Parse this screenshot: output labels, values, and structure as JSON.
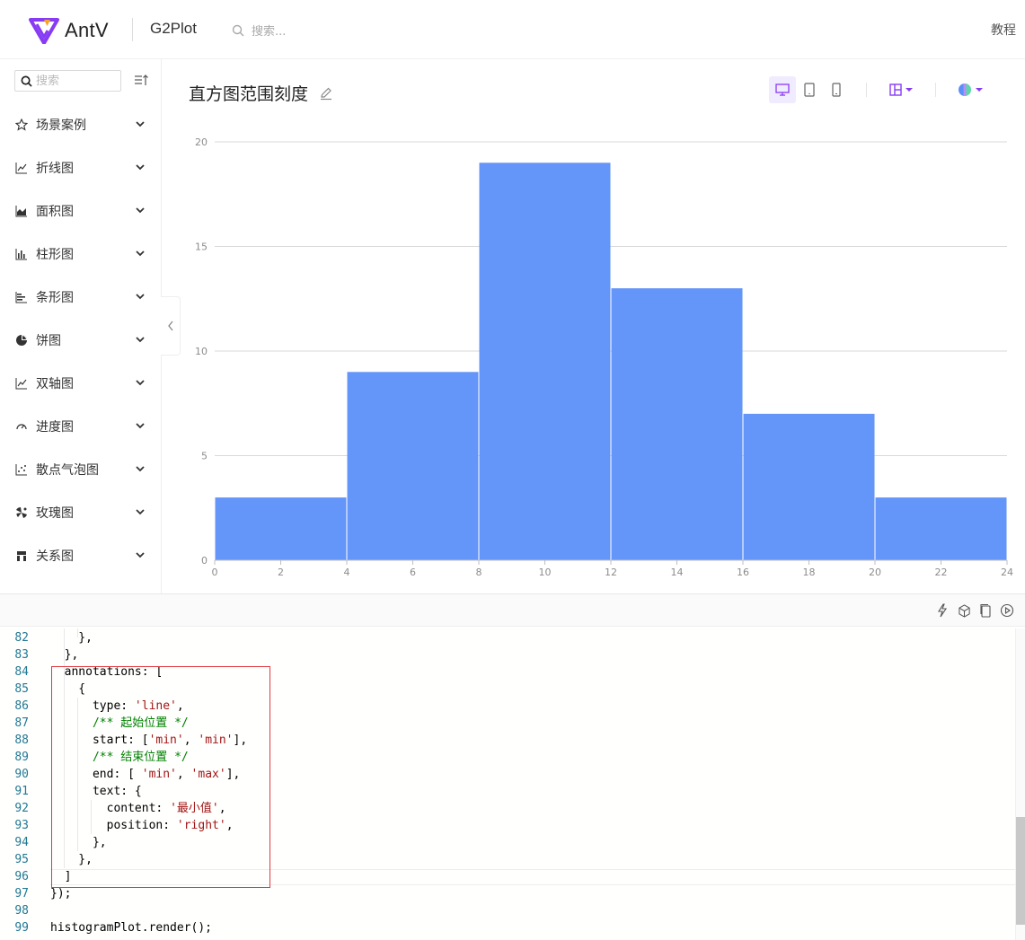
{
  "header": {
    "brand": "AntV",
    "product": "G2Plot",
    "search_placeholder": "搜索...",
    "tutorial": "教程"
  },
  "sidebar": {
    "search_placeholder": "搜索",
    "items": [
      {
        "label": "场景案例",
        "icon": "star-icon"
      },
      {
        "label": "折线图",
        "icon": "line-chart-icon"
      },
      {
        "label": "面积图",
        "icon": "area-chart-icon"
      },
      {
        "label": "柱形图",
        "icon": "column-chart-icon"
      },
      {
        "label": "条形图",
        "icon": "bar-chart-icon"
      },
      {
        "label": "饼图",
        "icon": "pie-chart-icon"
      },
      {
        "label": "双轴图",
        "icon": "dual-axes-icon"
      },
      {
        "label": "进度图",
        "icon": "gauge-icon"
      },
      {
        "label": "散点气泡图",
        "icon": "scatter-icon"
      },
      {
        "label": "玫瑰图",
        "icon": "rose-chart-icon"
      },
      {
        "label": "关系图",
        "icon": "relation-chart-icon"
      }
    ]
  },
  "page": {
    "title": "直方图范围刻度"
  },
  "colors": {
    "bar": "#6495f9",
    "accent": "#873bf4",
    "highlight_box": "#e0393e"
  },
  "chart_data": {
    "type": "bar",
    "bins": [
      [
        0,
        4
      ],
      [
        4,
        8
      ],
      [
        8,
        12
      ],
      [
        12,
        16
      ],
      [
        16,
        20
      ],
      [
        20,
        24
      ]
    ],
    "values": [
      3,
      9,
      19,
      13,
      7,
      3
    ],
    "x_ticks": [
      "0",
      "2",
      "4",
      "6",
      "8",
      "10",
      "12",
      "14",
      "16",
      "18",
      "20",
      "22",
      "24"
    ],
    "y_ticks": [
      "0",
      "5",
      "10",
      "15",
      "20"
    ],
    "xlim": [
      0,
      24
    ],
    "ylim": [
      0,
      20
    ],
    "grid": true
  },
  "code": {
    "lines": [
      {
        "n": "82",
        "t": [
          [
            "    },",
            ""
          ]
        ]
      },
      {
        "n": "83",
        "t": [
          [
            "  },",
            ""
          ]
        ]
      },
      {
        "n": "84",
        "t": [
          [
            "  annotations: [",
            ""
          ]
        ]
      },
      {
        "n": "85",
        "t": [
          [
            "    {",
            ""
          ]
        ]
      },
      {
        "n": "86",
        "t": [
          [
            "      type: ",
            ""
          ],
          [
            "'line'",
            "str"
          ],
          [
            ",",
            ""
          ]
        ]
      },
      {
        "n": "87",
        "t": [
          [
            "      /** 起始位置 */",
            "com"
          ]
        ]
      },
      {
        "n": "88",
        "t": [
          [
            "      start: [",
            ""
          ],
          [
            "'min'",
            "str"
          ],
          [
            ", ",
            ""
          ],
          [
            "'min'",
            "str"
          ],
          [
            "],",
            ""
          ]
        ]
      },
      {
        "n": "89",
        "t": [
          [
            "      /** 结束位置 */",
            "com"
          ]
        ]
      },
      {
        "n": "90",
        "t": [
          [
            "      end: [ ",
            ""
          ],
          [
            "'min'",
            "str"
          ],
          [
            ", ",
            ""
          ],
          [
            "'max'",
            "str"
          ],
          [
            "],",
            ""
          ]
        ]
      },
      {
        "n": "91",
        "t": [
          [
            "      text: {",
            ""
          ]
        ]
      },
      {
        "n": "92",
        "t": [
          [
            "        content: ",
            ""
          ],
          [
            "'最小值'",
            "str"
          ],
          [
            ",",
            ""
          ]
        ]
      },
      {
        "n": "93",
        "t": [
          [
            "        position: ",
            ""
          ],
          [
            "'right'",
            "str"
          ],
          [
            ",",
            ""
          ]
        ]
      },
      {
        "n": "94",
        "t": [
          [
            "      },",
            ""
          ]
        ]
      },
      {
        "n": "95",
        "t": [
          [
            "    },",
            ""
          ]
        ]
      },
      {
        "n": "96",
        "t": [
          [
            "  ]",
            ""
          ]
        ]
      },
      {
        "n": "97",
        "t": [
          [
            "});",
            ""
          ]
        ]
      },
      {
        "n": "98",
        "t": [
          [
            "",
            ""
          ]
        ]
      },
      {
        "n": "99",
        "t": [
          [
            "histogramPlot.render();",
            ""
          ]
        ]
      }
    ]
  }
}
